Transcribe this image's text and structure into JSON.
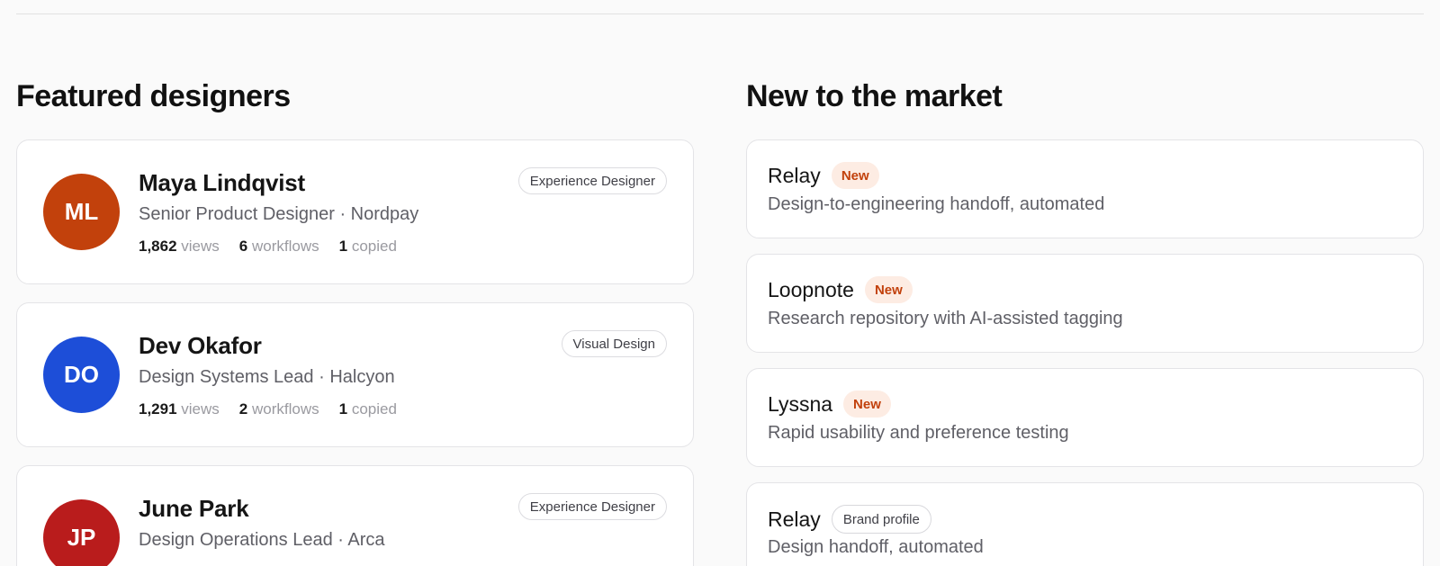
{
  "featured": {
    "title": "Featured designers",
    "designers": [
      {
        "initials": "ML",
        "avatar_color": "#c2410c",
        "name": "Maya Lindqvist",
        "role": "Senior Product Designer · Nordpay",
        "tag": "Experience Designer",
        "views": "1,862",
        "views_label": "views",
        "workflows": "6",
        "workflows_label": "workflows",
        "copied": "1",
        "copied_label": "copied"
      },
      {
        "initials": "DO",
        "avatar_color": "#1d4ed8",
        "name": "Dev Okafor",
        "role": "Design Systems Lead · Halcyon",
        "tag": "Visual Design",
        "views": "1,291",
        "views_label": "views",
        "workflows": "2",
        "workflows_label": "workflows",
        "copied": "1",
        "copied_label": "copied"
      },
      {
        "initials": "JP",
        "avatar_color": "#b91c1c",
        "name": "June Park",
        "role": "Design Operations Lead · Arca",
        "tag": "Experience Designer"
      }
    ]
  },
  "market": {
    "title": "New to the market",
    "products": [
      {
        "name": "Relay",
        "badge": "New",
        "description": "Design-to-engineering handoff, automated"
      },
      {
        "name": "Loopnote",
        "badge": "New",
        "description": "Research repository with AI-assisted tagging"
      },
      {
        "name": "Lyssna",
        "badge": "New",
        "description": "Rapid usability and preference testing"
      },
      {
        "name": "Relay",
        "badge": "Brand profile",
        "description": "Design handoff, automated"
      }
    ]
  }
}
